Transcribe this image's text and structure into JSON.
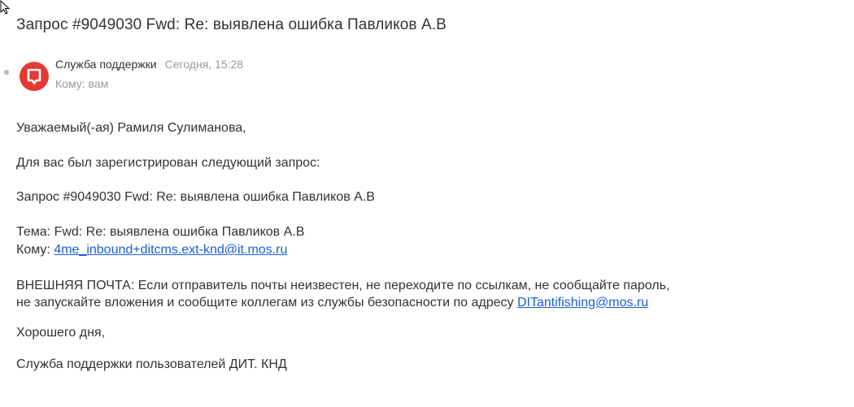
{
  "message": {
    "subject": "Запрос #9049030 Fwd: Re: выявлена ошибка Павликов А.В",
    "sender": {
      "name": "Служба поддержки",
      "time": "Сегодня, 15:28",
      "to": "Кому: вам",
      "avatar_color": "#e53935"
    },
    "body": {
      "greeting": "Уважаемый(-ая) Рамиля Сулиманова,",
      "registered": "Для вас был зарегистрирован следующий запрос:",
      "request": "Запрос #9049030 Fwd: Re: выявлена ошибка Павликов А.В",
      "topic": "Тема: Fwd: Re: выявлена ошибка Павликов А.В",
      "to_prefix": "Кому: ",
      "to_email": "4me_inbound+ditcms.ext-knd@it.mos.ru",
      "warning_line1": "ВНЕШНЯЯ ПОЧТА: Если отправитель почты неизвестен, не переходите по ссылкам, не сообщайте пароль,",
      "warning_line2_prefix": "не запускайте вложения и сообщите коллегам из службы безопасности по адресу ",
      "security_email": "DITantifishing@mos.ru",
      "wishes": "Хорошего дня,",
      "signature": "Служба поддержки пользователей ДИТ. КНД"
    }
  },
  "colors": {
    "link": "#1a5fd6",
    "text": "#333333",
    "muted": "#999999"
  },
  "icons": {
    "cursor": "mouse-pointer-icon",
    "avatar": "support-chat-icon",
    "unread": "unread-dot-icon"
  }
}
